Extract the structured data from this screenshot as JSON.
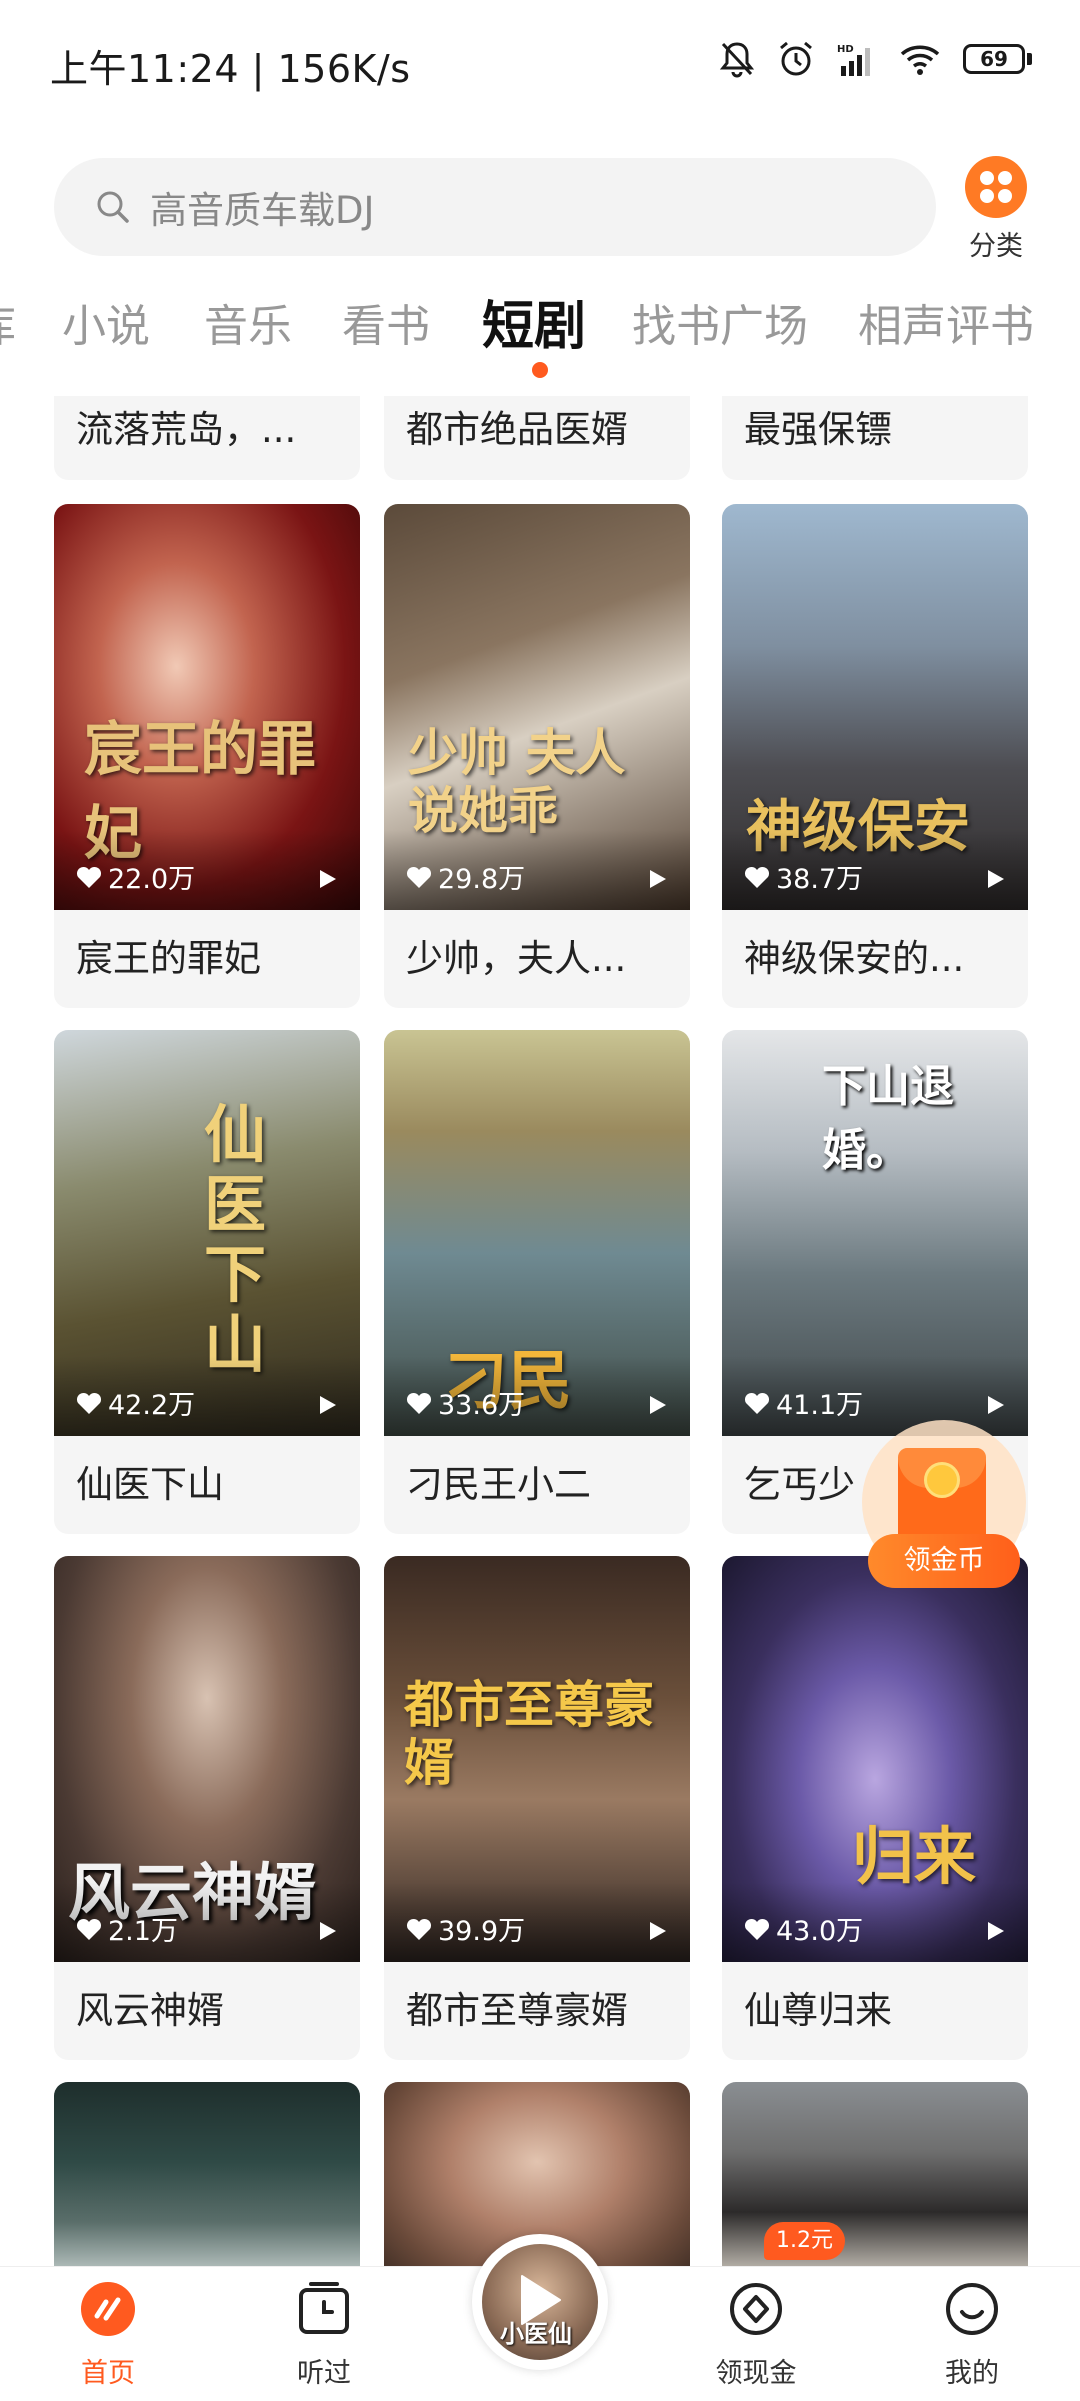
{
  "status_bar": {
    "time_speed": "上午11:24 | 156K/s",
    "battery": "69"
  },
  "search": {
    "placeholder": "高音质车载DJ"
  },
  "category_button": {
    "label": "分类"
  },
  "tabs": [
    {
      "label": "小说"
    },
    {
      "label": "音乐"
    },
    {
      "label": "看书"
    },
    {
      "label": "短剧"
    },
    {
      "label": "找书广场"
    },
    {
      "label": "相声评书"
    }
  ],
  "tab_partial_left": "库",
  "active_tab": "短剧",
  "top_row": [
    {
      "title": "流落荒岛，..."
    },
    {
      "title": "都市绝品医婿"
    },
    {
      "title": "最强保镖"
    }
  ],
  "dramas": [
    {
      "title": "宸王的罪妃",
      "likes": "22.0万",
      "poster_text": "宸王的罪妃"
    },
    {
      "title": "少帅，夫人...",
      "likes": "29.8万",
      "poster_text": "少帅 夫人说她乖"
    },
    {
      "title": "神级保安的...",
      "likes": "38.7万",
      "poster_text": "神级保安"
    },
    {
      "title": "仙医下山",
      "likes": "42.2万",
      "poster_text": "仙医下山"
    },
    {
      "title": "刁民王小二",
      "likes": "33.6万",
      "poster_text": "刁民"
    },
    {
      "title": "乞丐少",
      "likes": "41.1万",
      "poster_text": "下山退婚。"
    },
    {
      "title": "风云神婿",
      "likes": "2.1万",
      "poster_text": "风云神婿"
    },
    {
      "title": "都市至尊豪婿",
      "likes": "39.9万",
      "poster_text": "都市至尊豪婿"
    },
    {
      "title": "仙尊归来",
      "likes": "43.0万",
      "poster_text": "归来"
    }
  ],
  "coin_widget": {
    "label": "领金币"
  },
  "bottom_nav": {
    "home": "首页",
    "history": "听过",
    "player_title": "小医仙",
    "cash": "领现金",
    "cash_badge": "1.2元",
    "profile": "我的"
  },
  "colors": {
    "accent": "#ff5a1f",
    "tab_inactive": "#999999",
    "card_bg": "#f5f5f5"
  }
}
